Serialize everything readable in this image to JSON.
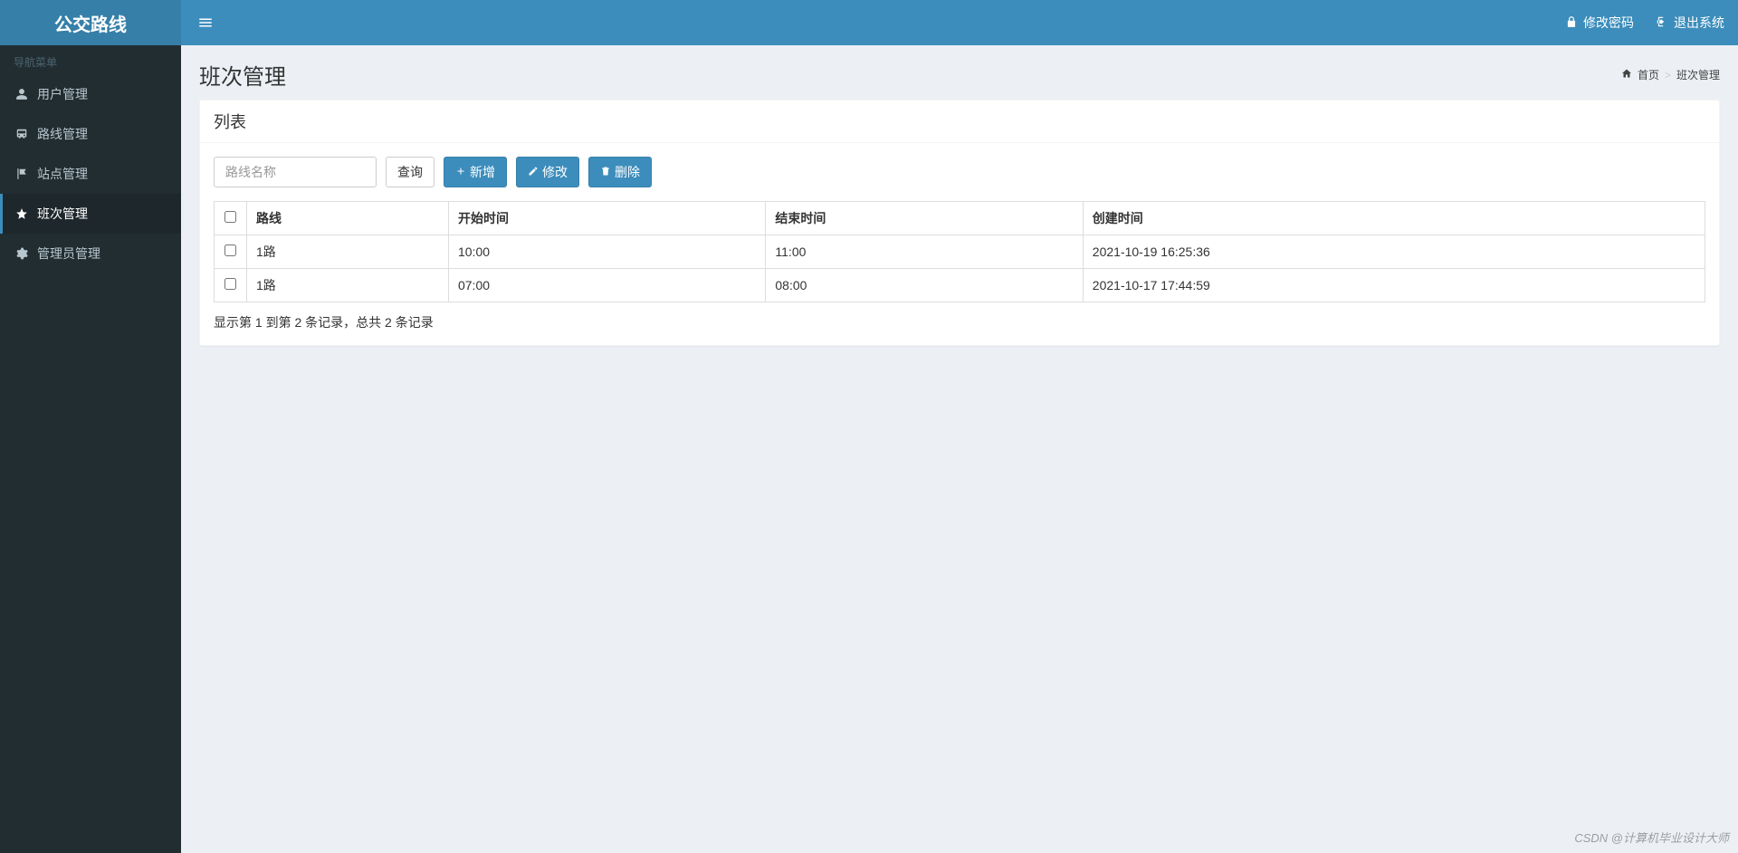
{
  "sidebar": {
    "logo": "公交路线",
    "header": "导航菜单",
    "items": [
      {
        "label": "用户管理",
        "icon": "user-icon",
        "active": false
      },
      {
        "label": "路线管理",
        "icon": "route-icon",
        "active": false
      },
      {
        "label": "站点管理",
        "icon": "flag-icon",
        "active": false
      },
      {
        "label": "班次管理",
        "icon": "star-icon",
        "active": true
      },
      {
        "label": "管理员管理",
        "icon": "gear-icon",
        "active": false
      }
    ]
  },
  "navbar": {
    "change_password": "修改密码",
    "logout": "退出系统"
  },
  "page": {
    "title": "班次管理",
    "breadcrumb_home": "首页",
    "breadcrumb_current": "班次管理"
  },
  "box": {
    "title": "列表"
  },
  "toolbar": {
    "search_placeholder": "路线名称",
    "search_label": "查询",
    "add_label": "新增",
    "edit_label": "修改",
    "delete_label": "删除"
  },
  "table": {
    "headers": {
      "route": "路线",
      "start": "开始时间",
      "end": "结束时间",
      "created": "创建时间"
    },
    "rows": [
      {
        "route": "1路",
        "start": "10:00",
        "end": "11:00",
        "created": "2021-10-19 16:25:36"
      },
      {
        "route": "1路",
        "start": "07:00",
        "end": "08:00",
        "created": "2021-10-17 17:44:59"
      }
    ],
    "footer": "显示第 1 到第 2 条记录，总共 2 条记录"
  },
  "watermark": "CSDN @计算机毕业设计大师"
}
